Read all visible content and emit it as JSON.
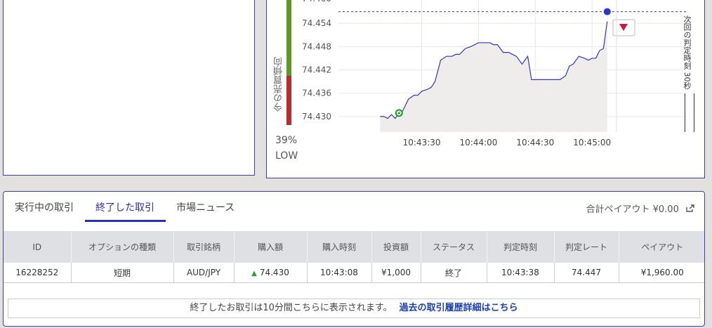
{
  "trend": {
    "label": "今の売買傾向",
    "percent": "39%",
    "direction": "LOW",
    "up_color": "#5a9a1c",
    "down_color": "#c0282b"
  },
  "timer": {
    "label": "次回の判定時刻 30秒"
  },
  "chart_data": {
    "type": "area",
    "y_ticks": [
      "74.454",
      "74.448",
      "74.442",
      "74.436",
      "74.430"
    ],
    "x_ticks": [
      "10:43:30",
      "10:44:00",
      "10:44:30",
      "10:45:00"
    ],
    "ylim": [
      74.426,
      74.46
    ],
    "current_rate": 74.457,
    "entry_rate": 74.43,
    "times": [
      0,
      2,
      4,
      6,
      8,
      10,
      12,
      15,
      18,
      20,
      22,
      25,
      27,
      29,
      32,
      35,
      38,
      40,
      42,
      45,
      48,
      50,
      52,
      55,
      58,
      60,
      62,
      65,
      68,
      70,
      72,
      75,
      78,
      80,
      82,
      85,
      88,
      90,
      92,
      95,
      98,
      100,
      102,
      105,
      108,
      110,
      112,
      114,
      116,
      118,
      120
    ],
    "values": [
      74.43,
      74.43,
      74.4295,
      74.4305,
      74.4295,
      74.431,
      74.4315,
      74.4345,
      74.4355,
      74.4355,
      74.4365,
      74.437,
      74.4375,
      74.439,
      74.4445,
      74.4455,
      74.4455,
      74.446,
      74.446,
      74.4475,
      74.448,
      74.4485,
      74.449,
      74.449,
      74.449,
      74.4485,
      74.4485,
      74.4465,
      74.4465,
      74.446,
      74.4455,
      74.4435,
      74.4455,
      74.4395,
      74.4395,
      74.4395,
      74.4395,
      74.4395,
      74.4395,
      74.4395,
      74.4405,
      74.443,
      74.4435,
      74.4455,
      74.445,
      74.4445,
      74.445,
      74.445,
      74.447,
      74.4475,
      74.4545
    ]
  },
  "tabs": [
    {
      "label": "実行中の取引"
    },
    {
      "label": "終了した取引"
    },
    {
      "label": "市場ニュース"
    }
  ],
  "payout_total": "合計ペイアウト ¥0.00",
  "table": {
    "headers": [
      "ID",
      "オプションの種類",
      "取引銘柄",
      "購入額",
      "購入時刻",
      "投資額",
      "ステータス",
      "判定時刻",
      "判定レート",
      "ペイアウト"
    ],
    "row": {
      "id": "16228252",
      "type": "短期",
      "symbol": "AUD/JPY",
      "purchase_rate": "74.430",
      "purchase_time": "10:43:08",
      "investment": "¥1,000",
      "status": "終了",
      "judge_time": "10:43:38",
      "judge_rate": "74.447",
      "payout": "¥1,960.00"
    }
  },
  "notice": {
    "text": "終了したお取引は10分間こちらに表示されます。",
    "link": "過去の取引履歴詳細はこちら"
  }
}
